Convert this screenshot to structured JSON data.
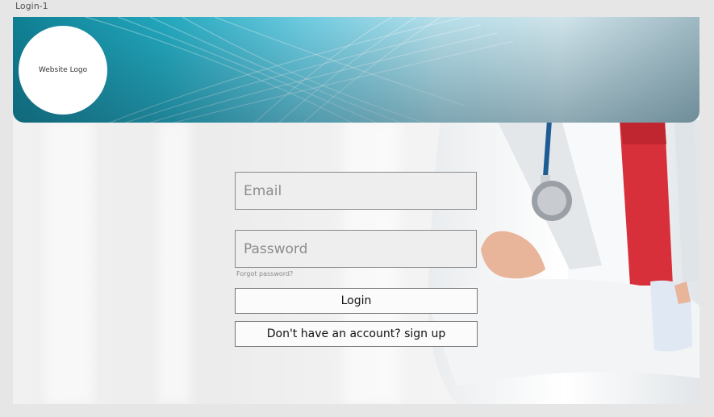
{
  "artboard": {
    "title": "Login-1"
  },
  "header": {
    "logo_text": "Website Logo"
  },
  "form": {
    "email_placeholder": "Email",
    "password_placeholder": "Password",
    "forgot_password": "Forgot password?",
    "login_label": "Login",
    "signup_label": "Don't have an account? sign up"
  },
  "colors": {
    "header_teal": "#22a7bd",
    "field_bg": "#eeeeee",
    "tie_red": "#d8303a"
  }
}
